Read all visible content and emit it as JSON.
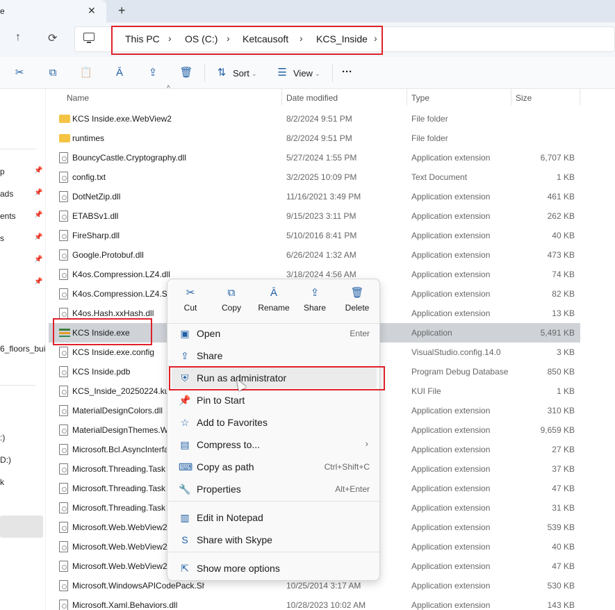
{
  "tab": {
    "title": "e",
    "close": "✕",
    "new": "+"
  },
  "nav": {
    "up": "↑",
    "refresh": "⟳"
  },
  "breadcrumb": [
    {
      "label": "This PC"
    },
    {
      "label": "OS (C:)"
    },
    {
      "label": "Ketcausoft"
    },
    {
      "label": "KCS_Inside"
    }
  ],
  "breadcrumb_sep": "›",
  "commands": {
    "cut_icon": "✂",
    "copy_icon": "⧉",
    "paste_icon": "📋",
    "rename_icon": "Ā",
    "share_icon": "⇪",
    "delete_icon": "🗑",
    "sort_label": "Sort",
    "view_label": "View",
    "more": "···"
  },
  "sidebar": [
    {
      "label": "p",
      "pinned": true
    },
    {
      "label": "ads",
      "pinned": true
    },
    {
      "label": "ents",
      "pinned": true
    },
    {
      "label": "s",
      "pinned": true
    },
    {
      "label": "",
      "pinned": true
    },
    {
      "label": "",
      "pinned": true
    },
    {
      "label": "6_floors_bui"
    },
    {
      "label": ":)"
    },
    {
      "label": "D:)"
    },
    {
      "label": "k"
    }
  ],
  "columns": {
    "name": "Name",
    "date": "Date modified",
    "type": "Type",
    "size": "Size"
  },
  "files": [
    {
      "name": "KCS Inside.exe.WebView2",
      "date": "8/2/2024 9:51 PM",
      "type": "File folder",
      "size": "",
      "icon": "folder"
    },
    {
      "name": "runtimes",
      "date": "8/2/2024 9:51 PM",
      "type": "File folder",
      "size": "",
      "icon": "folder"
    },
    {
      "name": "BouncyCastle.Cryptography.dll",
      "date": "5/27/2024 1:55 PM",
      "type": "Application extension",
      "size": "6,707 KB",
      "icon": "file"
    },
    {
      "name": "config.txt",
      "date": "3/2/2025 10:09 PM",
      "type": "Text Document",
      "size": "1 KB",
      "icon": "file"
    },
    {
      "name": "DotNetZip.dll",
      "date": "11/16/2021 3:49 PM",
      "type": "Application extension",
      "size": "461 KB",
      "icon": "file"
    },
    {
      "name": "ETABSv1.dll",
      "date": "9/15/2023 3:11 PM",
      "type": "Application extension",
      "size": "262 KB",
      "icon": "file"
    },
    {
      "name": "FireSharp.dll",
      "date": "5/10/2016 8:41 PM",
      "type": "Application extension",
      "size": "40 KB",
      "icon": "file"
    },
    {
      "name": "Google.Protobuf.dll",
      "date": "6/26/2024 1:32 AM",
      "type": "Application extension",
      "size": "473 KB",
      "icon": "file"
    },
    {
      "name": "K4os.Compression.LZ4.dll",
      "date": "3/18/2024 4:56 AM",
      "type": "Application extension",
      "size": "74 KB",
      "icon": "file"
    },
    {
      "name": "K4os.Compression.LZ4.St",
      "date": "",
      "type": "Application extension",
      "size": "82 KB",
      "icon": "file"
    },
    {
      "name": "K4os.Hash.xxHash.dll",
      "date": "",
      "type": "Application extension",
      "size": "13 KB",
      "icon": "file"
    },
    {
      "name": "KCS Inside.exe",
      "date": "",
      "type": "Application",
      "size": "5,491 KB",
      "icon": "app",
      "selected": true
    },
    {
      "name": "KCS Inside.exe.config",
      "date": "",
      "type": "VisualStudio.config.14.0",
      "size": "3 KB",
      "icon": "file"
    },
    {
      "name": "KCS Inside.pdb",
      "date": "",
      "type": "Program Debug Database",
      "size": "850 KB",
      "icon": "file"
    },
    {
      "name": "KCS_Inside_20250224.kui",
      "date": "",
      "type": "KUI File",
      "size": "1 KB",
      "icon": "file"
    },
    {
      "name": "MaterialDesignColors.dll",
      "date": "",
      "type": "Application extension",
      "size": "310 KB",
      "icon": "file"
    },
    {
      "name": "MaterialDesignThemes.W",
      "date": "",
      "type": "Application extension",
      "size": "9,659 KB",
      "icon": "file"
    },
    {
      "name": "Microsoft.Bcl.AsyncInterfa",
      "date": "",
      "type": "Application extension",
      "size": "27 KB",
      "icon": "file"
    },
    {
      "name": "Microsoft.Threading.Task",
      "date": "",
      "type": "Application extension",
      "size": "37 KB",
      "icon": "file"
    },
    {
      "name": "Microsoft.Threading.Task",
      "date": "",
      "type": "Application extension",
      "size": "47 KB",
      "icon": "file"
    },
    {
      "name": "Microsoft.Threading.Task",
      "date": "",
      "type": "Application extension",
      "size": "31 KB",
      "icon": "file"
    },
    {
      "name": "Microsoft.Web.WebView2",
      "date": "",
      "type": "Application extension",
      "size": "539 KB",
      "icon": "file"
    },
    {
      "name": "Microsoft.Web.WebView2",
      "date": "",
      "type": "Application extension",
      "size": "40 KB",
      "icon": "file"
    },
    {
      "name": "Microsoft.Web.WebView2",
      "date": "",
      "type": "Application extension",
      "size": "47 KB",
      "icon": "file"
    },
    {
      "name": "Microsoft.WindowsAPICodePack.Shell.dll",
      "date": "10/25/2014 3:17 AM",
      "type": "Application extension",
      "size": "530 KB",
      "icon": "file"
    },
    {
      "name": "Microsoft.Xaml.Behaviors.dll",
      "date": "10/28/2023 10:02 AM",
      "type": "Application extension",
      "size": "143 KB",
      "icon": "file"
    }
  ],
  "context_menu": {
    "quick_actions": [
      {
        "label": "Cut",
        "icon": "✂"
      },
      {
        "label": "Copy",
        "icon": "⧉"
      },
      {
        "label": "Rename",
        "icon": "Ā"
      },
      {
        "label": "Share",
        "icon": "⇪"
      },
      {
        "label": "Delete",
        "icon": "🗑"
      }
    ],
    "items": [
      {
        "label": "Open",
        "key": "Enter",
        "icon": "▣"
      },
      {
        "label": "Share",
        "key": "",
        "icon": "⇪"
      },
      {
        "label": "Run as administrator",
        "key": "",
        "icon": "⛨",
        "hover": true
      },
      {
        "label": "Pin to Start",
        "key": "",
        "icon": "📌"
      },
      {
        "label": "Add to Favorites",
        "key": "",
        "icon": "☆"
      },
      {
        "label": "Compress to...",
        "key": "",
        "icon": "▤",
        "submenu": true
      },
      {
        "label": "Copy as path",
        "key": "Ctrl+Shift+C",
        "icon": "⌨"
      },
      {
        "label": "Properties",
        "key": "Alt+Enter",
        "icon": "🔧"
      },
      {
        "label": "Edit in Notepad",
        "key": "",
        "icon": "▥"
      },
      {
        "label": "Share with Skype",
        "key": "",
        "icon": "S"
      },
      {
        "label": "Show more options",
        "key": "",
        "icon": "⇱"
      }
    ],
    "submenu_arrow": "›"
  },
  "colors": {
    "highlight_red": "#e0202a",
    "accent": "#1f5fa5",
    "selected_row": "#cfd3d8"
  }
}
